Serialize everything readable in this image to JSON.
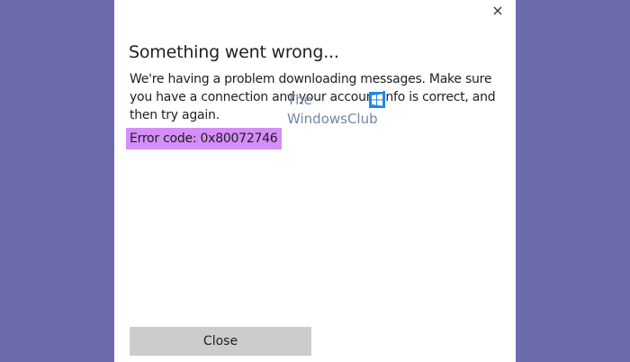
{
  "dialog": {
    "title": "Something went wrong...",
    "message": "We're having a problem downloading messages. Make sure you have a connection and your account info is correct, and then try again.",
    "error_code": "Error code: 0x80072746",
    "close_label": "Close",
    "close_icon": "×"
  },
  "watermark": {
    "line1": "The",
    "line2": "WindowsClub"
  },
  "colors": {
    "background": "#6c6cad",
    "dialog": "#ffffff",
    "error_highlight": "#d58ef7",
    "button": "#cccccc"
  }
}
